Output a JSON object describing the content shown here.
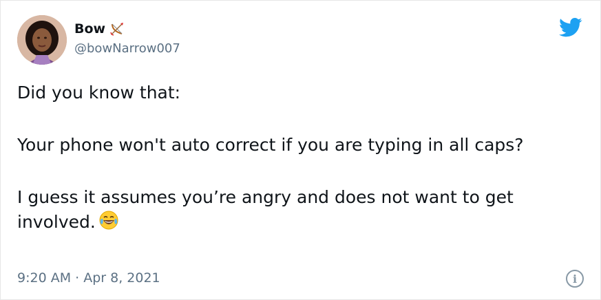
{
  "author": {
    "display_name": "Bow",
    "handle": "@bowNarrow007",
    "name_emoji": "bow-and-arrow-icon",
    "avatar": "user-avatar"
  },
  "brand": {
    "icon": "twitter-bird-icon",
    "color": "#1da1f2"
  },
  "tweet": {
    "line1": "Did you know that:",
    "line2": "Your phone won't auto correct if you are typing in all caps?",
    "line3": "I guess it assumes you’re angry and does not want to get involved.",
    "line3_emoji": "face-with-tears-of-joy-icon",
    "timestamp": "9:20 AM · Apr 8, 2021"
  },
  "footer": {
    "info_icon": "info-icon",
    "info_glyph": "i"
  }
}
